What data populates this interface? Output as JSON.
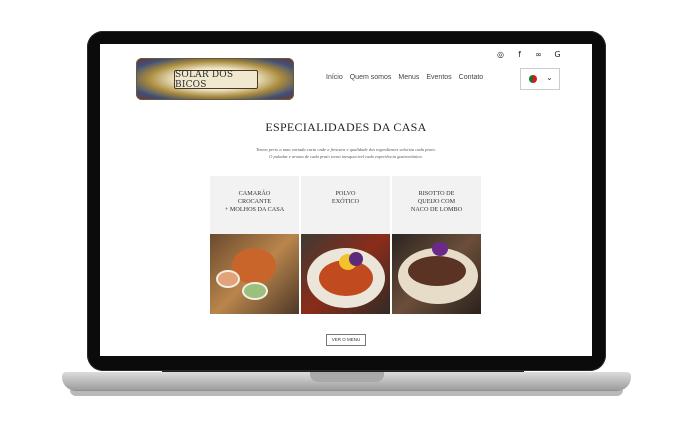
{
  "header": {
    "logo_text": "SOLAR DOS BICOS",
    "social_icons": [
      "instagram-icon",
      "facebook-icon",
      "tripadvisor-icon",
      "google-icon"
    ],
    "nav": [
      "Início",
      "Quem somos",
      "Menus",
      "Eventos",
      "Contato"
    ]
  },
  "main": {
    "title": "ESPECIALIDADES DA CASA",
    "intro_line1": "Tenem perto a uma variada carta onde a frescura e qualidade dos ingredientes valoriza cada prato.",
    "intro_line2": "O paladar e aroma de cada prato torna inesquecível cada experiência gastronómica.",
    "cards": [
      {
        "label": "CAMARÃO\nCROCANTE\n+ MOLHOS DA CASA"
      },
      {
        "label": "POLVO\nEXÓTICO"
      },
      {
        "label": "RISOTTO DE\nQUEIJO COM\nNACO DE LOMBO"
      }
    ],
    "cta_label": "VER O MENU"
  },
  "colors": {
    "frame": "#0b0b0b",
    "card_bg": "#f2f2f2",
    "text": "#222222"
  }
}
